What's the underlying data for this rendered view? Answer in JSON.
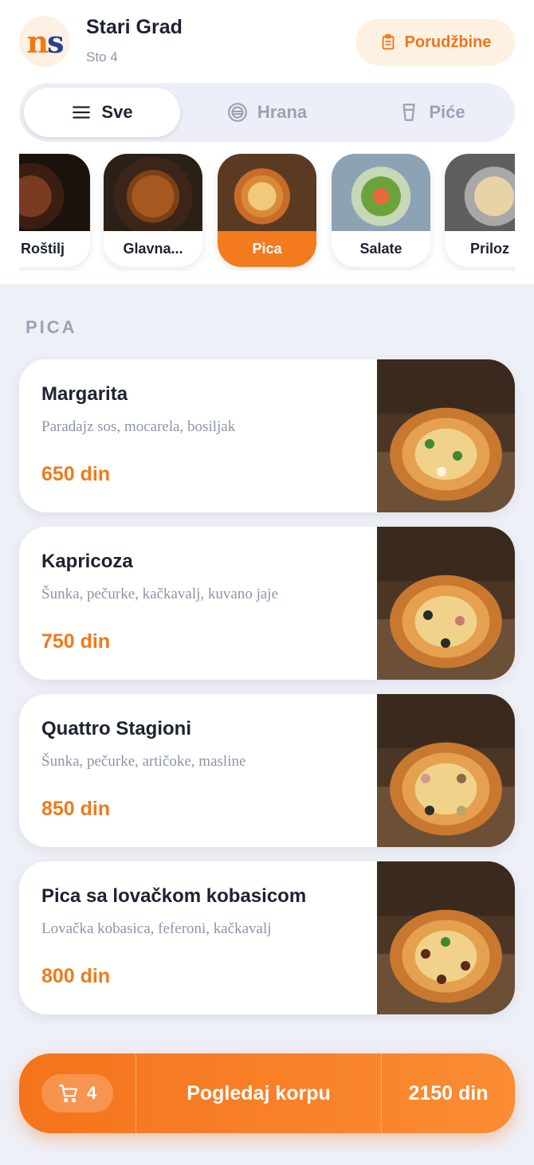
{
  "header": {
    "logo_text": "ns",
    "venue_name": "Stari Grad",
    "table_label": "Sto 4",
    "orders_button": "Porudžbine",
    "orders_icon": "clipboard-icon"
  },
  "segments": [
    {
      "label": "Sve",
      "icon": "menu-icon",
      "active": true
    },
    {
      "label": "Hrana",
      "icon": "plate-icon",
      "active": false
    },
    {
      "label": "Piće",
      "icon": "glass-icon",
      "active": false
    }
  ],
  "categories": [
    {
      "label": "Roštilj",
      "active": false
    },
    {
      "label": "Glavna...",
      "active": false
    },
    {
      "label": "Pica",
      "active": true
    },
    {
      "label": "Salate",
      "active": false
    },
    {
      "label": "Priloz",
      "active": false
    }
  ],
  "section": {
    "title": "PICA"
  },
  "items": [
    {
      "name": "Margarita",
      "description": "Paradajz sos, mocarela, bosiljak",
      "price": "650 din"
    },
    {
      "name": "Kapricoza",
      "description": "Šunka, pečurke, kačkavalj, kuvano jaje",
      "price": "750 din"
    },
    {
      "name": "Quattro Stagioni",
      "description": "Šunka, pečurke, artičoke, masline",
      "price": "850 din"
    },
    {
      "name": "Pica sa lovačkom kobasicom",
      "description": "Lovačka kobasica, feferoni, kačkavalj",
      "price": "800 din"
    }
  ],
  "cart": {
    "count": "4",
    "label": "Pogledaj korpu",
    "total": "2150 din",
    "icon": "cart-icon"
  },
  "colors": {
    "accent": "#f47a1f",
    "background": "#eef0f7",
    "text_primary": "#1d2230",
    "text_muted": "#8d95a8"
  }
}
